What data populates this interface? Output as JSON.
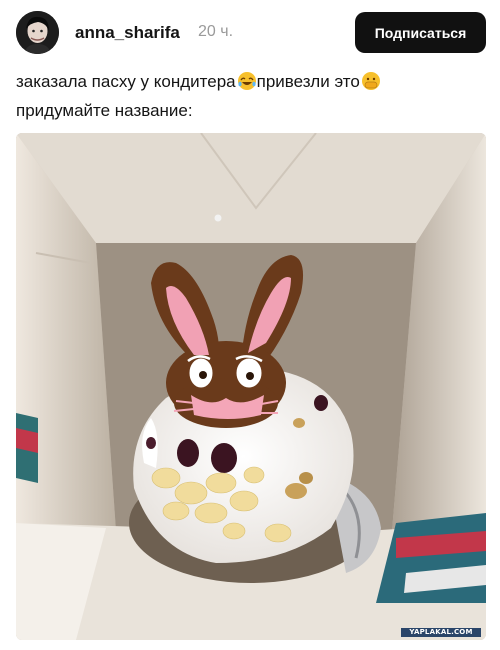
{
  "post": {
    "username": "anna_sharifa",
    "time": "20 ч.",
    "subscribe_label": "Подписаться",
    "caption_line1_part1": "заказала пасху у кондитера",
    "caption_line1_part2": "привезли это",
    "caption_line2": "придумайте название:",
    "emoji_1": "rofl-emoji",
    "emoji_2": "shocked-covering-mouth-emoji"
  },
  "photo": {
    "subject": "kulich-with-gingerbread-bunny-photo",
    "watermark": "YAPLAKAL.COM"
  }
}
